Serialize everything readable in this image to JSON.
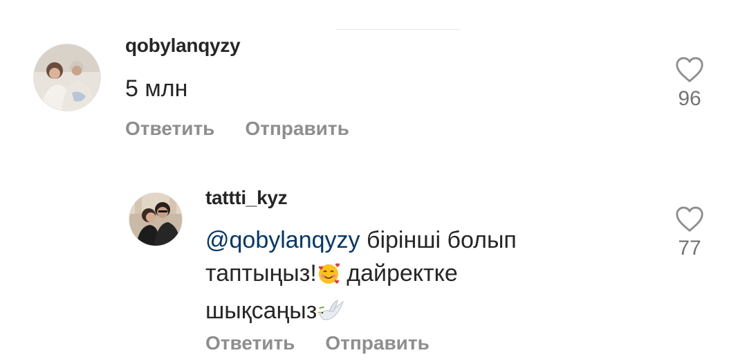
{
  "comments": [
    {
      "username": "qobylanqyzy",
      "text": "5 млн",
      "likes": "96",
      "actions": {
        "reply": "Ответить",
        "send": "Отправить"
      },
      "icons": {
        "like": "heart-outline-icon"
      }
    },
    {
      "username": "tattti_kyz",
      "mention": "@qobylanqyzy",
      "text_line1": " бірінші болып",
      "text_line2a": "таптыңыз!",
      "text_line2b": " дайректке",
      "text_line3": "шықсаңыз",
      "likes": "77",
      "actions": {
        "reply": "Ответить",
        "send": "Отправить"
      },
      "icons": {
        "like": "heart-outline-icon",
        "emoji1": "smiling-face-with-hearts-icon",
        "emoji2": "dove-icon"
      }
    }
  ]
}
